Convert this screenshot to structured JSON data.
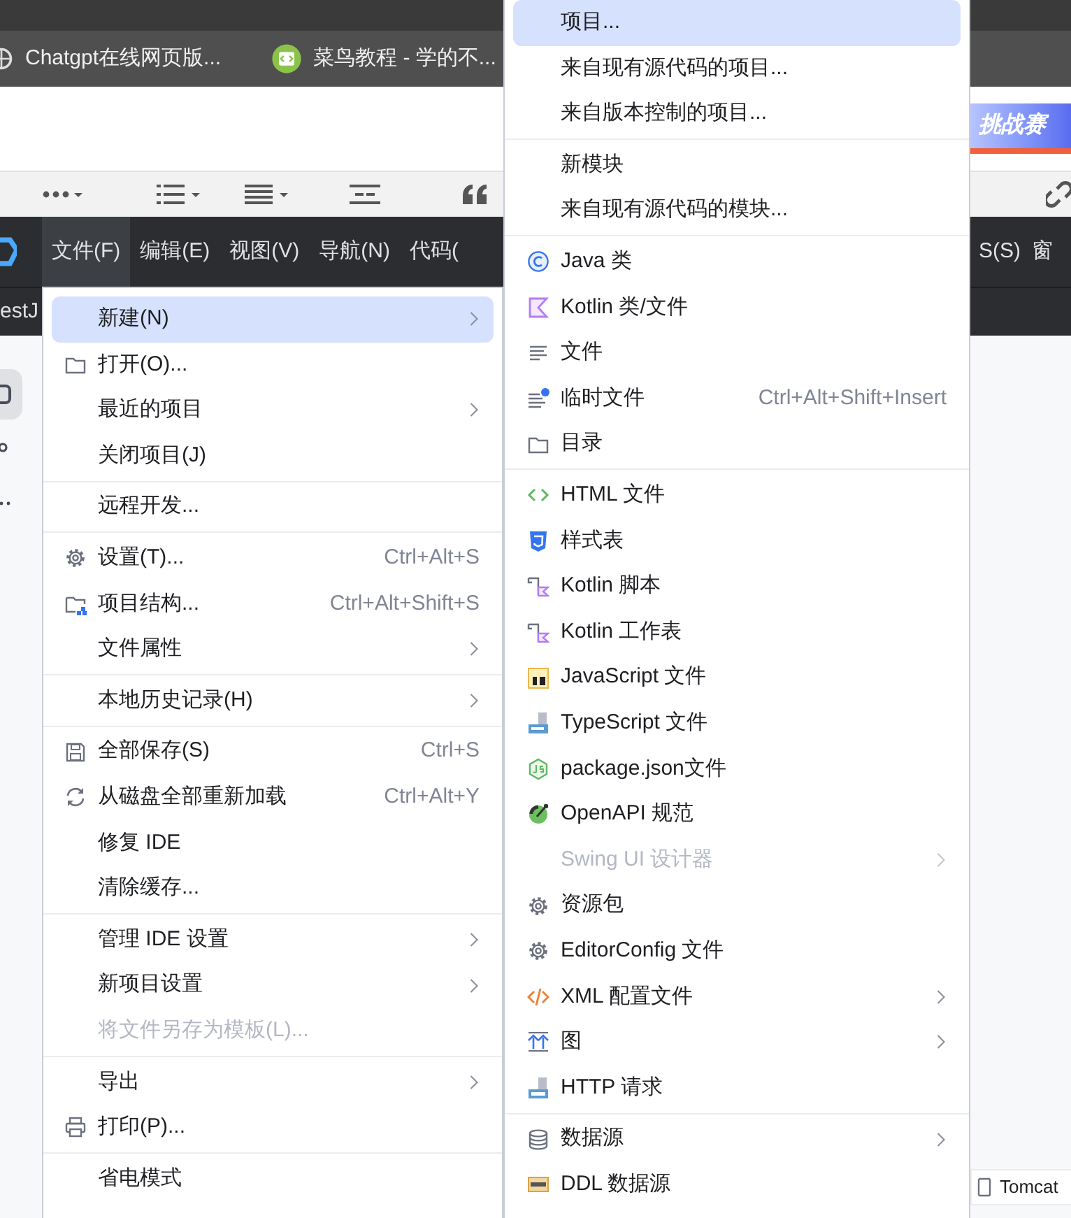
{
  "bookmarks": [
    {
      "label": "Chatgpt在线网页版..."
    },
    {
      "label": "菜鸟教程 - 学的不..."
    }
  ],
  "banner": {
    "text": "挑战赛"
  },
  "menu_bar": {
    "items": [
      {
        "label": "文件(F)",
        "selected": true
      },
      {
        "label": "编辑(E)",
        "selected": false
      },
      {
        "label": "视图(V)",
        "selected": false
      },
      {
        "label": "导航(N)",
        "selected": false
      },
      {
        "label": "代码(",
        "selected": false
      }
    ],
    "right_items": [
      {
        "label": "S(S)",
        "selected": false
      },
      {
        "label": "窗",
        "selected": false
      }
    ]
  },
  "side_panel": {
    "tab_text": "estJ"
  },
  "file_menu": {
    "groups": [
      [
        {
          "label": "新建(N)",
          "submenu": true,
          "selected": true,
          "disabled": false
        },
        {
          "label": "打开(O)...",
          "submenu": false,
          "selected": false,
          "disabled": false
        },
        {
          "label": "最近的项目",
          "submenu": true,
          "selected": false,
          "disabled": false
        },
        {
          "label": "关闭项目(J)",
          "submenu": false,
          "selected": false,
          "disabled": false
        }
      ],
      [
        {
          "label": "远程开发...",
          "submenu": false,
          "selected": false,
          "disabled": false
        }
      ],
      [
        {
          "label": "设置(T)...",
          "shortcut": "Ctrl+Alt+S",
          "submenu": false,
          "selected": false,
          "disabled": false
        },
        {
          "label": "项目结构...",
          "shortcut": "Ctrl+Alt+Shift+S",
          "submenu": false,
          "selected": false,
          "disabled": false
        },
        {
          "label": "文件属性",
          "submenu": true,
          "selected": false,
          "disabled": false
        }
      ],
      [
        {
          "label": "本地历史记录(H)",
          "submenu": true,
          "selected": false,
          "disabled": false
        }
      ],
      [
        {
          "label": "全部保存(S)",
          "shortcut": "Ctrl+S",
          "submenu": false,
          "selected": false,
          "disabled": false
        },
        {
          "label": "从磁盘全部重新加载",
          "shortcut": "Ctrl+Alt+Y",
          "submenu": false,
          "selected": false,
          "disabled": false
        },
        {
          "label": "修复 IDE",
          "submenu": false,
          "selected": false,
          "disabled": false
        },
        {
          "label": "清除缓存...",
          "submenu": false,
          "selected": false,
          "disabled": false
        }
      ],
      [
        {
          "label": "管理 IDE 设置",
          "submenu": true,
          "selected": false,
          "disabled": false
        },
        {
          "label": "新项目设置",
          "submenu": true,
          "selected": false,
          "disabled": false
        },
        {
          "label": "将文件另存为模板(L)...",
          "submenu": false,
          "selected": false,
          "disabled": true
        }
      ],
      [
        {
          "label": "导出",
          "submenu": true,
          "selected": false,
          "disabled": false
        },
        {
          "label": "打印(P)...",
          "submenu": false,
          "selected": false,
          "disabled": false
        }
      ],
      [
        {
          "label": "省电模式",
          "submenu": false,
          "selected": false,
          "disabled": false
        }
      ]
    ]
  },
  "new_submenu": {
    "groups": [
      [
        {
          "label": "项目...",
          "submenu": false,
          "selected": true,
          "disabled": false
        },
        {
          "label": "来自现有源代码的项目...",
          "submenu": false,
          "selected": false,
          "disabled": false
        },
        {
          "label": "来自版本控制的项目...",
          "submenu": false,
          "selected": false,
          "disabled": false
        }
      ],
      [
        {
          "label": "新模块",
          "submenu": false,
          "selected": false,
          "disabled": false
        },
        {
          "label": "来自现有源代码的模块...",
          "submenu": false,
          "selected": false,
          "disabled": false
        }
      ],
      [
        {
          "label": "Java 类",
          "submenu": false,
          "selected": false,
          "disabled": false
        },
        {
          "label": "Kotlin 类/文件",
          "submenu": false,
          "selected": false,
          "disabled": false
        },
        {
          "label": "文件",
          "submenu": false,
          "selected": false,
          "disabled": false
        },
        {
          "label": "临时文件",
          "shortcut": "Ctrl+Alt+Shift+Insert",
          "submenu": false,
          "selected": false,
          "disabled": false
        },
        {
          "label": "目录",
          "submenu": false,
          "selected": false,
          "disabled": false
        }
      ],
      [
        {
          "label": "HTML 文件",
          "submenu": false,
          "selected": false,
          "disabled": false
        },
        {
          "label": "样式表",
          "submenu": false,
          "selected": false,
          "disabled": false
        },
        {
          "label": "Kotlin 脚本",
          "submenu": false,
          "selected": false,
          "disabled": false
        },
        {
          "label": "Kotlin 工作表",
          "submenu": false,
          "selected": false,
          "disabled": false
        },
        {
          "label": "JavaScript 文件",
          "submenu": false,
          "selected": false,
          "disabled": false
        },
        {
          "label": "TypeScript 文件",
          "submenu": false,
          "selected": false,
          "disabled": false
        },
        {
          "label": "package.json文件",
          "submenu": false,
          "selected": false,
          "disabled": false
        },
        {
          "label": "OpenAPI 规范",
          "submenu": false,
          "selected": false,
          "disabled": false
        },
        {
          "label": "Swing UI 设计器",
          "submenu": true,
          "selected": false,
          "disabled": true
        },
        {
          "label": "资源包",
          "submenu": false,
          "selected": false,
          "disabled": false
        },
        {
          "label": "EditorConfig 文件",
          "submenu": false,
          "selected": false,
          "disabled": false
        },
        {
          "label": "XML 配置文件",
          "submenu": true,
          "selected": false,
          "disabled": false
        },
        {
          "label": "图",
          "submenu": true,
          "selected": false,
          "disabled": false
        },
        {
          "label": "HTTP 请求",
          "submenu": false,
          "selected": false,
          "disabled": false
        }
      ],
      [
        {
          "label": "数据源",
          "submenu": true,
          "selected": false,
          "disabled": false
        },
        {
          "label": "DDL 数据源",
          "submenu": false,
          "selected": false,
          "disabled": false
        }
      ]
    ]
  },
  "run_config": {
    "label": "Tomcat"
  }
}
